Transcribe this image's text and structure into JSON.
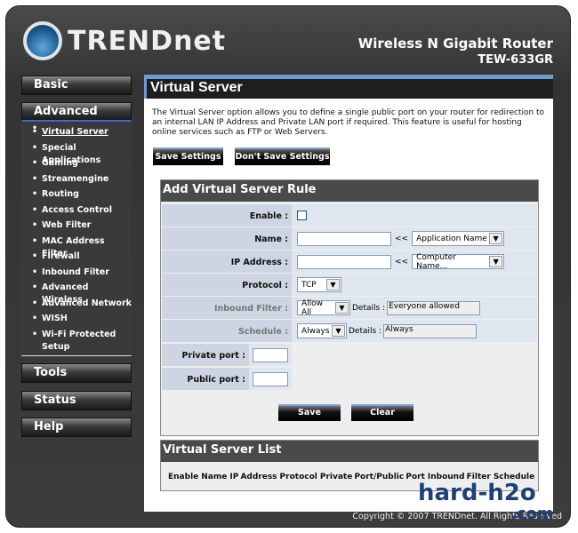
{
  "header": {
    "brand": "TRENDnet",
    "product": "Wireless N Gigabit Router",
    "model": "TEW-633GR"
  },
  "sidebar": {
    "basic": "Basic",
    "advanced": "Advanced",
    "items": [
      "Virtual Server",
      "Special Applications",
      "Gaming",
      "Streamengine",
      "Routing",
      "Access Control",
      "Web Filter",
      "MAC Address Filter",
      "Firewall",
      "Inbound Filter",
      "Advanced Wireless",
      "Advanced Network",
      "WISH",
      "Wi-Fi Protected Setup"
    ],
    "tools": "Tools",
    "status": "Status",
    "help": "Help"
  },
  "main": {
    "title": "Virtual Server",
    "description": "The Virtual Server option allows you to define a single public port on your router for redirection to an internal LAN IP Address and Private LAN port if required. This feature is useful for hosting online services such as FTP or Web Servers.",
    "save_settings": "Save Settings",
    "dont_save_settings": "Don't Save Settings"
  },
  "rule": {
    "title": "Add Virtual Server Rule",
    "enable": "Enable :",
    "name": "Name :",
    "name_value": "",
    "ip": "IP Address :",
    "ip_value": "",
    "arrows": "<<",
    "app_select": "Application Name",
    "computer_select": "Computer Name...",
    "protocol": "Protocol :",
    "protocol_value": "TCP",
    "inbound": "Inbound Filter :",
    "inbound_value": "Allow All",
    "details": "Details :",
    "inbound_details": "Everyone allowed",
    "schedule": "Schedule :",
    "schedule_value": "Always",
    "schedule_details": "Always",
    "private_port": "Private port :",
    "public_port": "Public port :",
    "save": "Save",
    "clear": "Clear"
  },
  "list": {
    "title": "Virtual Server List",
    "columns": [
      "Enable",
      "Name",
      "IP Address",
      "Protocol",
      "Private Port/Public Port",
      "Inbound Filter",
      "Schedule"
    ]
  },
  "footer": {
    "copyright": "Copyright © 2007 TRENDnet. All Rights Reserved"
  },
  "watermark": {
    "line1": "hard-h2o",
    "line2": ".com"
  }
}
